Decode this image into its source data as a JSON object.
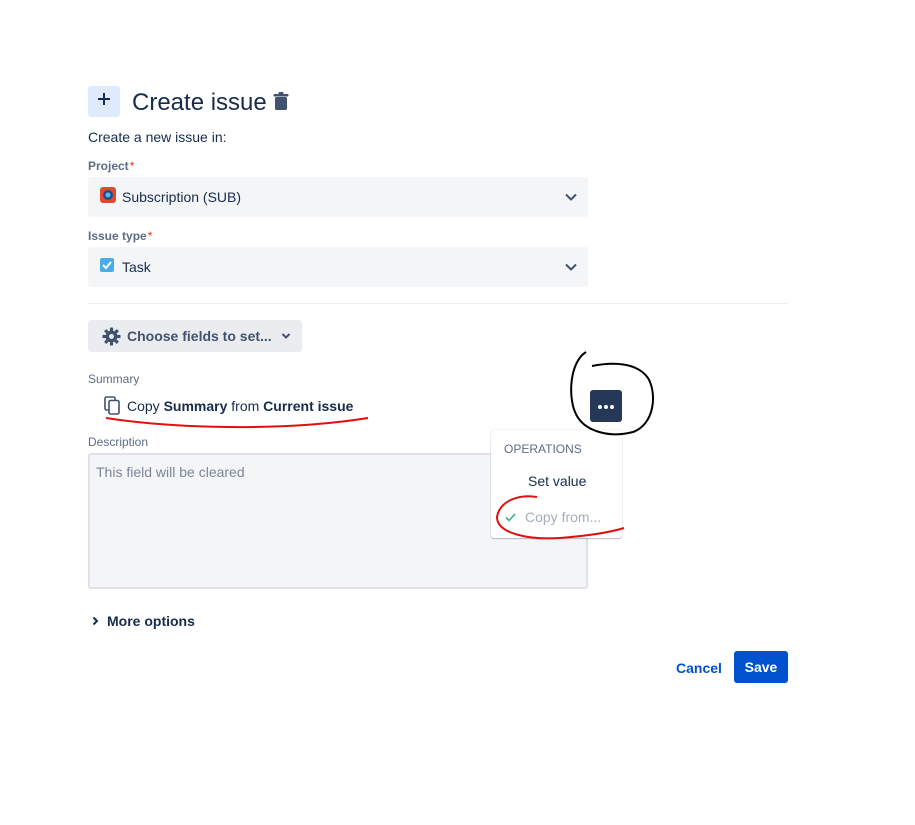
{
  "header": {
    "title": "Create issue",
    "subtitle": "Create a new issue in:",
    "plus_icon": "plus-icon",
    "trash_icon": "trash-icon"
  },
  "project": {
    "label": "Project",
    "required_mark": "*",
    "value": "Subscription (SUB)",
    "icon": "project-avatar-icon"
  },
  "issue_type": {
    "label": "Issue type",
    "required_mark": "*",
    "value": "Task",
    "icon": "task-checkbox-icon"
  },
  "choose_fields": {
    "label": "Choose fields to set..."
  },
  "summary": {
    "label": "Summary",
    "copy_prefix": "Copy",
    "field": "Summary",
    "from_word": "from",
    "source": "Current issue"
  },
  "description": {
    "label": "Description",
    "placeholder": "This field will be cleared"
  },
  "operations_menu": {
    "heading": "OPERATIONS",
    "items": [
      "Set value",
      "Copy from..."
    ],
    "selected": "Copy from..."
  },
  "more_options": {
    "label": "More options"
  },
  "footer": {
    "cancel_label": "Cancel",
    "save_label": "Save"
  },
  "colors": {
    "primary": "#0052cc",
    "text": "#172b4d",
    "subtle": "#5e6c84",
    "required": "#de350b",
    "annotation_red": "#e01010",
    "annotation_black": "#000000"
  }
}
